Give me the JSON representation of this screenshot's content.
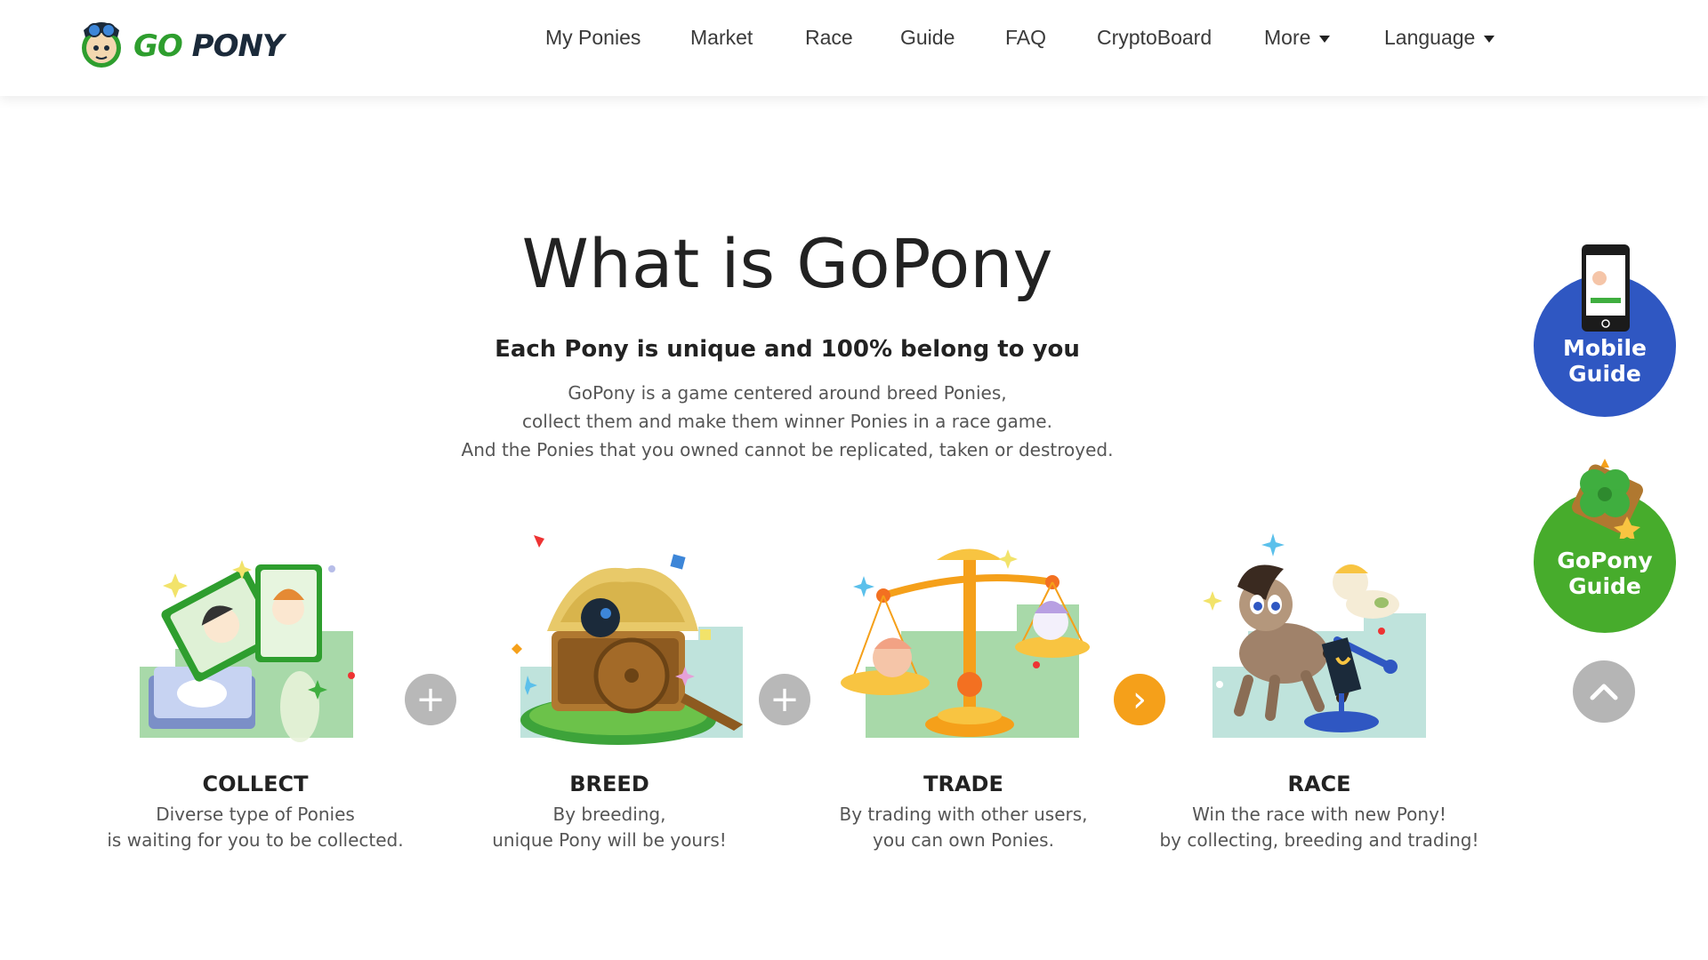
{
  "header": {
    "logo": {
      "go": "GO",
      "pony": "PONY"
    },
    "nav": [
      {
        "label": "My Ponies"
      },
      {
        "label": "Market"
      },
      {
        "label": "Race"
      },
      {
        "label": "Guide"
      },
      {
        "label": "FAQ"
      },
      {
        "label": "CryptoBoard"
      },
      {
        "label": "More",
        "dropdown": true
      },
      {
        "label": "Language",
        "dropdown": true
      }
    ]
  },
  "intro": {
    "title": "What is GoPony",
    "subtitle": "Each Pony is unique and 100% belong to you",
    "lines": [
      "GoPony is a game centered around breed Ponies,",
      "collect them and make them winner Ponies in a race game.",
      "And the Ponies that you owned cannot be replicated, taken or destroyed."
    ]
  },
  "steps": [
    {
      "title": "COLLECT",
      "lines": [
        "Diverse type of Ponies",
        "is waiting for you to be collected."
      ]
    },
    {
      "title": "BREED",
      "lines": [
        "By breeding,",
        "unique Pony will be yours!"
      ]
    },
    {
      "title": "TRADE",
      "lines": [
        "By trading with other users,",
        "you can own Ponies."
      ]
    },
    {
      "title": "RACE",
      "lines": [
        "Win the race with new Pony!",
        "by collecting, breeding and trading!"
      ]
    }
  ],
  "connectors": [
    {
      "icon": "plus-icon",
      "symbol": "+"
    },
    {
      "icon": "plus-icon",
      "symbol": "+"
    },
    {
      "icon": "chevron-right-icon",
      "symbol": "›"
    }
  ],
  "floating": {
    "mobile_guide": [
      "Mobile",
      "Guide"
    ],
    "gopony_guide": [
      "GoPony",
      "Guide"
    ],
    "scroll_top_icon": "chevron-up-icon"
  },
  "colors": {
    "brand_green": "#2e9e2e",
    "mobile_guide_blue": "#2f57c2",
    "gopony_guide_green": "#47ac2c",
    "arrow_orange": "#f5a01a"
  }
}
